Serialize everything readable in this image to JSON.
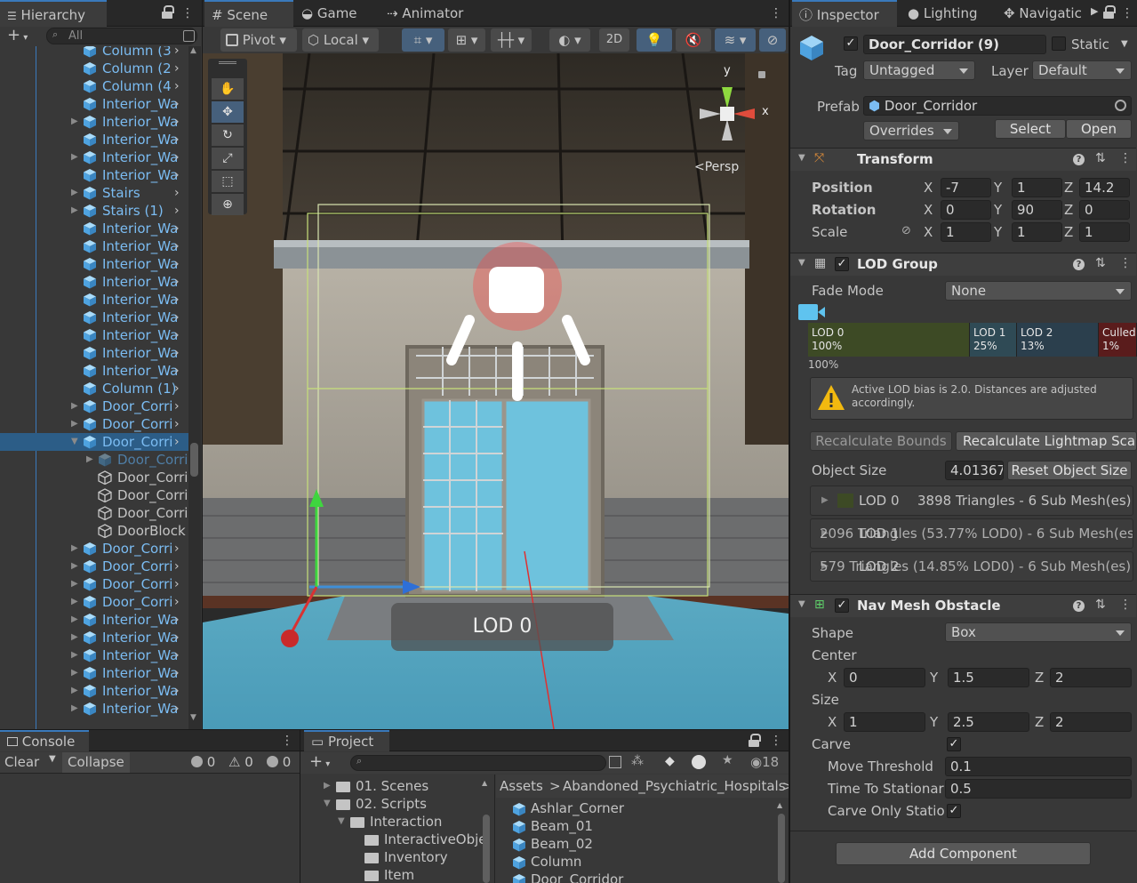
{
  "hierarchy": {
    "tab": "Hierarchy",
    "search_placeholder": "All",
    "rows": [
      {
        "label": "Column (3",
        "indent": 0,
        "arrow": false,
        "icon": "prefab",
        "partial": true
      },
      {
        "label": "Column (2",
        "arrow": false
      },
      {
        "label": "Column (4",
        "arrow": false
      },
      {
        "label": "Interior_Wa",
        "arrow": false
      },
      {
        "label": "Interior_Wa",
        "arrow": true
      },
      {
        "label": "Interior_Wa",
        "arrow": false
      },
      {
        "label": "Interior_Wa",
        "arrow": true
      },
      {
        "label": "Interior_Wa",
        "arrow": false
      },
      {
        "label": "Stairs",
        "arrow": true
      },
      {
        "label": "Stairs (1)",
        "arrow": true
      },
      {
        "label": "Interior_Wa",
        "arrow": false
      },
      {
        "label": "Interior_Wa",
        "arrow": false
      },
      {
        "label": "Interior_Wa",
        "arrow": false
      },
      {
        "label": "Interior_Wa",
        "arrow": false
      },
      {
        "label": "Interior_Wa",
        "arrow": false
      },
      {
        "label": "Interior_Wa",
        "arrow": false
      },
      {
        "label": "Interior_Wa",
        "arrow": false
      },
      {
        "label": "Interior_Wa",
        "arrow": false
      },
      {
        "label": "Interior_Wa",
        "arrow": false
      },
      {
        "label": "Column (1)",
        "arrow": false
      },
      {
        "label": "Door_Corri",
        "arrow": true
      },
      {
        "label": "Door_Corri",
        "arrow": true
      },
      {
        "label": "Door_Corri",
        "arrow": "open",
        "selected": true
      },
      {
        "label": "Door_Corric",
        "arrow": true,
        "child": true,
        "dim": true
      },
      {
        "label": "Door_Corri",
        "arrow": false,
        "child": true,
        "white": true
      },
      {
        "label": "Door_Corri",
        "arrow": false,
        "child": true,
        "white": true
      },
      {
        "label": "Door_Corri",
        "arrow": false,
        "child": true,
        "white": true
      },
      {
        "label": "DoorBlock",
        "arrow": false,
        "child": true,
        "white": true
      },
      {
        "label": "Door_Corri",
        "arrow": true
      },
      {
        "label": "Door_Corri",
        "arrow": true
      },
      {
        "label": "Door_Corri",
        "arrow": true
      },
      {
        "label": "Door_Corri",
        "arrow": true
      },
      {
        "label": "Interior_Wa",
        "arrow": true
      },
      {
        "label": "Interior_Wa",
        "arrow": true
      },
      {
        "label": "Interior_Wa",
        "arrow": true
      },
      {
        "label": "Interior_Wa",
        "arrow": true
      },
      {
        "label": "Interior_Wa",
        "arrow": true
      },
      {
        "label": "Interior_Wa",
        "arrow": true
      }
    ]
  },
  "scene": {
    "tabs": [
      "Scene",
      "Game",
      "Animator"
    ],
    "toolbar": {
      "pivot": "Pivot",
      "local": "Local",
      "mode2d": "2D"
    },
    "gizmo": {
      "y": "y",
      "x": "x",
      "persp": "Persp"
    },
    "lod_label": "LOD 0"
  },
  "console": {
    "tab": "Console",
    "clear": "Clear",
    "collapse": "Collapse",
    "counts": [
      "0",
      "0",
      "0"
    ]
  },
  "project": {
    "tab": "Project",
    "hidden_count": "18",
    "tree": [
      {
        "label": "01. Scenes",
        "depth": 0,
        "arrow": "closed"
      },
      {
        "label": "02. Scripts",
        "depth": 0,
        "arrow": "open"
      },
      {
        "label": "Interaction",
        "depth": 1,
        "arrow": "open"
      },
      {
        "label": "InteractiveObje",
        "depth": 2,
        "arrow": "none"
      },
      {
        "label": "Inventory",
        "depth": 2,
        "arrow": "none"
      },
      {
        "label": "Item",
        "depth": 2,
        "arrow": "none"
      }
    ],
    "breadcrumb": [
      "Assets",
      "Abandoned_Psychiatric_Hospitals"
    ],
    "assets": [
      "Ashlar_Corner",
      "Beam_01",
      "Beam_02",
      "Column",
      "Door_Corridor"
    ]
  },
  "inspector": {
    "tabs": [
      "Inspector",
      "Lighting",
      "Navigatic"
    ],
    "object_name": "Door_Corridor (9)",
    "static_label": "Static",
    "tag_label": "Tag",
    "tag_value": "Untagged",
    "layer_label": "Layer",
    "layer_value": "Default",
    "prefab_label": "Prefab",
    "prefab_value": "Door_Corridor",
    "overrides": "Overrides",
    "select": "Select",
    "open": "Open",
    "transform": {
      "title": "Transform",
      "position_label": "Position",
      "pos": [
        "-7",
        "1",
        "14.2"
      ],
      "rotation_label": "Rotation",
      "rot": [
        "0",
        "90",
        "0"
      ],
      "scale_label": "Scale",
      "scale": [
        "1",
        "1",
        "1"
      ]
    },
    "lod": {
      "title": "LOD Group",
      "fade_label": "Fade Mode",
      "fade_value": "None",
      "bar": [
        {
          "name": "LOD 0",
          "pct": "100%",
          "color": "#3d4a25"
        },
        {
          "name": "LOD 1",
          "pct": "25%",
          "color": "#2f4a55"
        },
        {
          "name": "LOD 2",
          "pct": "13%",
          "color": "#2b3f4d"
        },
        {
          "name": "Culled",
          "pct": "1%",
          "color": "#5a1c1c"
        }
      ],
      "marker": "100%",
      "warning": "Active LOD bias is 2.0. Distances are adjusted accordingly.",
      "recalc_bounds": "Recalculate Bounds",
      "recalc_lightmap": "Recalculate Lightmap Scale",
      "size_label": "Object Size",
      "size_value": "4.01367",
      "reset_size": "Reset Object Size",
      "entries": [
        {
          "name": "LOD 0",
          "info": "3898 Triangles  - 6 Sub Mesh(es)"
        },
        {
          "name": "LOD 1",
          "info": "2096 Triangles (53.77% LOD0) - 6 Sub Mesh(es)"
        },
        {
          "name": "LOD 2",
          "info": "579 Triangles (14.85% LOD0) - 6 Sub Mesh(es)"
        }
      ]
    },
    "nav": {
      "title": "Nav Mesh Obstacle",
      "shape_label": "Shape",
      "shape_value": "Box",
      "center_label": "Center",
      "center": [
        "0",
        "1.5",
        "2"
      ],
      "size_label": "Size",
      "size": [
        "1",
        "2.5",
        "2"
      ],
      "carve_label": "Carve",
      "move_label": "Move Threshold",
      "move_value": "0.1",
      "time_label": "Time To Stationar",
      "time_value": "0.5",
      "carve_only_label": "Carve Only Statio"
    },
    "add_component": "Add Component"
  }
}
